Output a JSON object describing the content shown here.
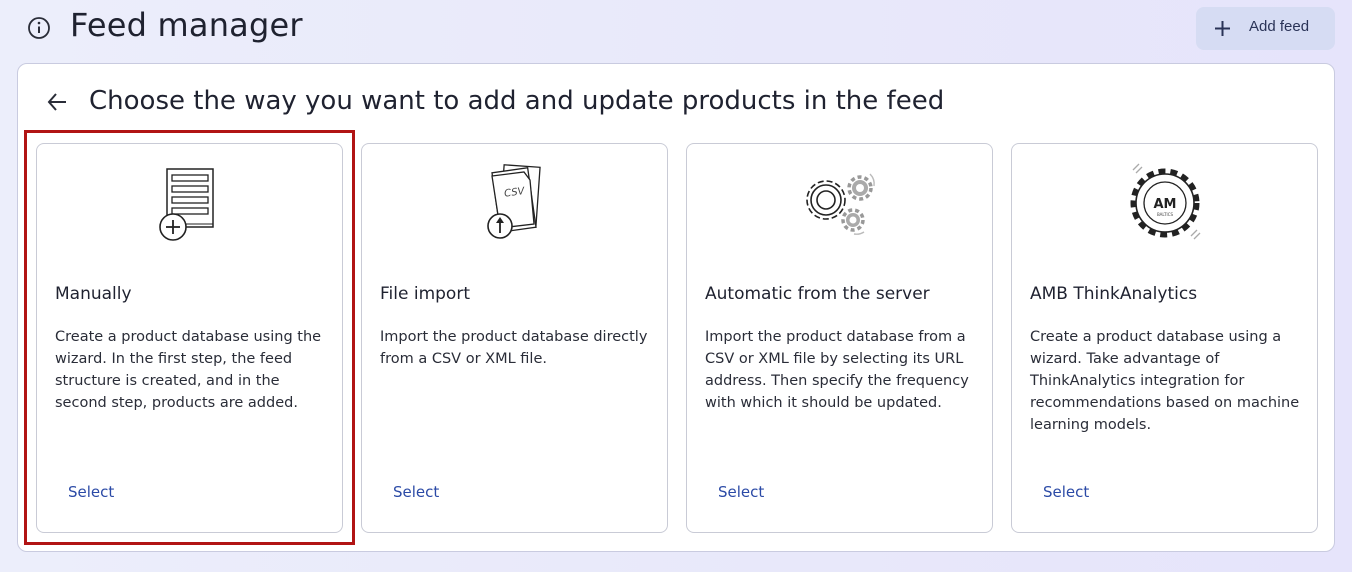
{
  "header": {
    "title": "Feed manager",
    "info_icon": "info-circle-icon",
    "add_feed_label": "Add feed",
    "add_feed_icon": "plus-icon"
  },
  "panel": {
    "back_icon": "arrow-left-icon",
    "title": "Choose the way you want to add and update products in the feed"
  },
  "cards": [
    {
      "icon": "document-add-icon",
      "title": "Manually",
      "description": "Create a product database using the wizard. In the first step, the feed structure is created, and in the second step, products are added.",
      "select_label": "Select",
      "highlighted": true
    },
    {
      "icon": "csv-upload-icon",
      "title": "File import",
      "description": "Import the product database directly from a CSV or XML file.",
      "select_label": "Select",
      "illustration_text": "CSV"
    },
    {
      "icon": "gears-icon",
      "title": "Automatic from the server",
      "description": "Import the product database from a CSV or XML file by selecting its URL address. Then specify the frequency with which it should be updated.",
      "select_label": "Select"
    },
    {
      "icon": "amb-gear-logo-icon",
      "title": "AMB ThinkAnalytics",
      "description": "Create a product database using a wizard. Take advantage of ThinkAnalytics integration for recommendations based on machine learning models.",
      "select_label": "Select",
      "logo_text": "AM",
      "logo_subtext": "BALTICS"
    }
  ],
  "colors": {
    "accent": "#2b4aa6",
    "highlight": "#b11414",
    "button_bg": "#d6dcf3"
  }
}
